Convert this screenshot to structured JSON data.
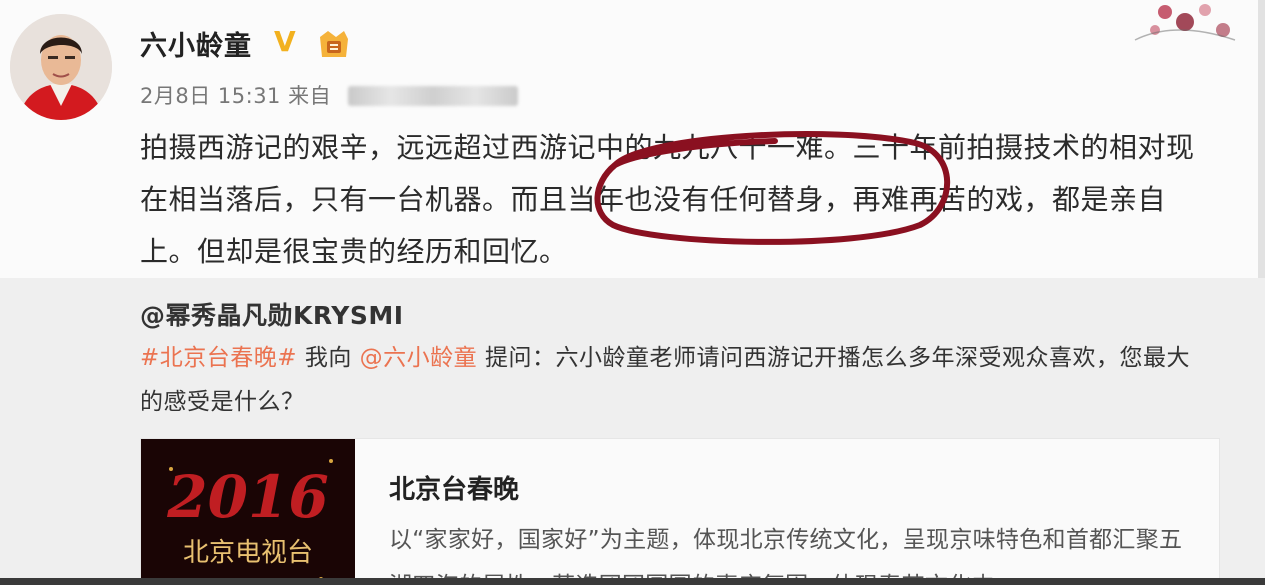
{
  "post": {
    "username": "六小龄童",
    "vip_mark": "V",
    "date": "2月8日 15:31",
    "from_label": "来自",
    "text": "拍摄西游记的艰辛，远远超过西游记中的九九八十一难。三十年前拍摄技术的相对现在相当落后，只有一台机器。而且当年也没有任何替身，再难再苦的戏，都是亲自上。但却是很宝贵的经历和回忆。"
  },
  "repost": {
    "author": "@幂秀晶凡勋KRYSMI",
    "hashtag": "#北京台春晚#",
    "ask_prefix": " 我向 ",
    "mention": "@六小龄童",
    "question": " 提问：六小龄童老师请问西游记开播怎么多年深受观众喜欢，您最大的感受是什么？"
  },
  "card": {
    "title": "北京台春晚",
    "description": "以“家家好，国家好”为主题，体现北京传统文化，呈现京味特色和首都汇聚五湖四海的属性，营造团团圆圆的喜庆氛围，体现春节文化内",
    "thumb_year": "2016",
    "thumb_caption": "北京电视台"
  },
  "colors": {
    "highlight_circle": "#8a1020",
    "link": "#eb7350",
    "vip": "#f2b11f"
  }
}
